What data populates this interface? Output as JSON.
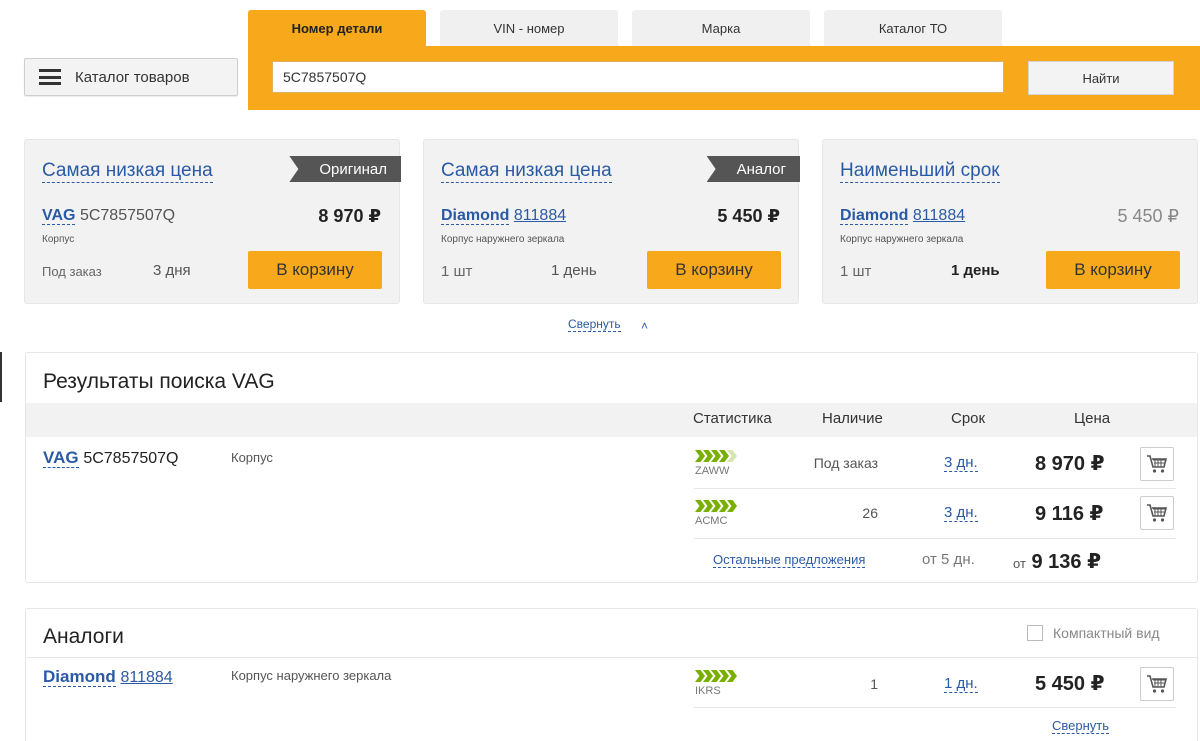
{
  "header": {
    "catalog_label": "Каталог товаров",
    "tabs": [
      {
        "label": "Номер детали",
        "active": true
      },
      {
        "label": "VIN - номер",
        "active": false
      },
      {
        "label": "Марка",
        "active": false
      },
      {
        "label": "Каталог ТО",
        "active": false
      }
    ],
    "search_value": "5C7857507Q",
    "search_button": "Найти"
  },
  "offers": [
    {
      "title": "Самая низкая цена",
      "flag": "Оригинал",
      "brand": "VAG",
      "number": "5C7857507Q",
      "description": "Корпус",
      "price": "8 970 ₽",
      "availability": "Под заказ",
      "term": "3 дня",
      "cart_label": "В корзину"
    },
    {
      "title": "Самая низкая цена",
      "flag": "Аналог",
      "brand": "Diamond",
      "number": "811884",
      "description": "Корпус наружнего зеркала",
      "price": "5 450 ₽",
      "availability": "1 шт",
      "term": "1 день",
      "cart_label": "В корзину"
    },
    {
      "title": "Наименьший срок",
      "brand": "Diamond",
      "number": "811884",
      "description": "Корпус наружнего зеркала",
      "price": "5 450 ₽",
      "availability": "1 шт",
      "term": "1 день",
      "cart_label": "В корзину"
    }
  ],
  "collapse_label": "Свернуть",
  "results": {
    "title": "Результаты поиска VAG",
    "columns": {
      "stats": "Статистика",
      "availability": "Наличие",
      "term": "Срок",
      "price": "Цена"
    },
    "brand": "VAG",
    "number": "5C7857507Q",
    "description": "Корпус",
    "rows": [
      {
        "stat_code": "ZAWW",
        "stat_level": 4,
        "availability": "Под заказ",
        "term": "3 дн.",
        "price": "8 970 ₽"
      },
      {
        "stat_code": "ACMC",
        "stat_level": 5,
        "availability": "26",
        "term": "3 дн.",
        "price": "9 116 ₽"
      }
    ],
    "other_offers": {
      "label": "Остальные предложения",
      "term": "от 5 дн.",
      "price_prefix": "от",
      "price": "9 136 ₽"
    }
  },
  "analogs": {
    "title": "Аналоги",
    "compact_label": "Компактный вид",
    "rows": [
      {
        "brand": "Diamond",
        "number": "811884",
        "description": "Корпус наружнего зеркала",
        "stat_code": "IKRS",
        "stat_level": 5,
        "availability": "1",
        "term": "1 дн.",
        "price": "5 450 ₽"
      }
    ],
    "collapse_label": "Свернуть"
  },
  "colors": {
    "accent": "#f7a81b",
    "link": "#2a5aa5",
    "stat_green": "#79b000",
    "flag": "#555555"
  }
}
